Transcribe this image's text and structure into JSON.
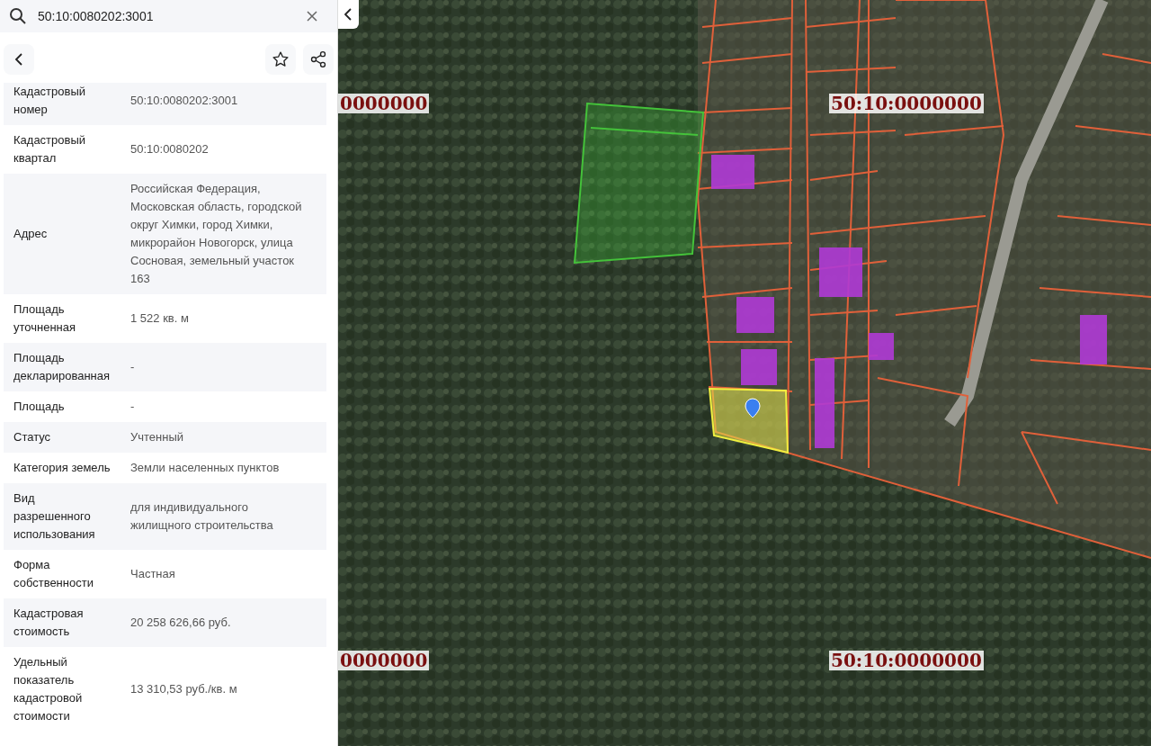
{
  "search": {
    "value": "50:10:0080202:3001"
  },
  "properties": [
    {
      "label": "Кадастровый номер",
      "value": "50:10:0080202:3001"
    },
    {
      "label": "Кадастровый квартал",
      "value": "50:10:0080202"
    },
    {
      "label": "Адрес",
      "value": "Российская Федерация, Московская область, городской округ Химки, город Химки, микрорайон Новогорск, улица Сосновая, земельный участок 163"
    },
    {
      "label": "Площадь уточненная",
      "value": "1 522 кв. м"
    },
    {
      "label": "Площадь декларированная",
      "value": "-"
    },
    {
      "label": "Площадь",
      "value": "-"
    },
    {
      "label": "Статус",
      "value": "Учтенный"
    },
    {
      "label": "Категория земель",
      "value": "Земли населенных пунктов"
    },
    {
      "label": "Вид разрешенного использования",
      "value": "для индивидуального жилищного строительства"
    },
    {
      "label": "Форма собственности",
      "value": "Частная"
    },
    {
      "label": "Кадастровая стоимость",
      "value": "20 258 626,66 руб."
    },
    {
      "label": "Удельный показатель кадастровой стоимости",
      "value": "13 310,53 руб./кв. м"
    }
  ],
  "map": {
    "quarter_labels": [
      "0000000",
      "50:10:0000000",
      "0000000",
      "50:10:0000000"
    ]
  }
}
